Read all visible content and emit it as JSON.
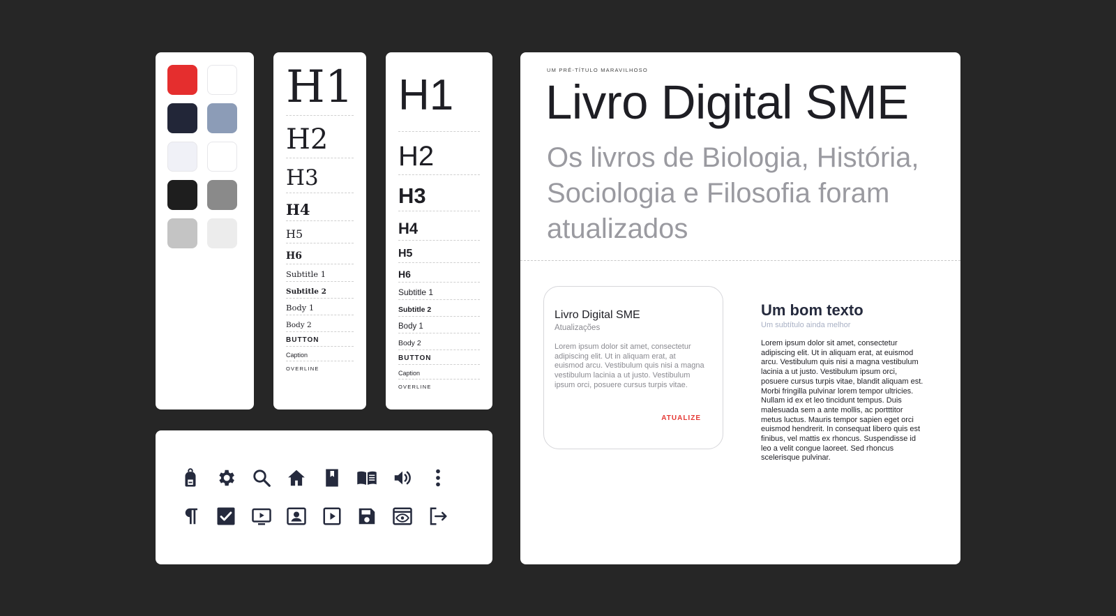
{
  "palette": {
    "swatches": [
      {
        "color": "#e52e2e",
        "name": "red"
      },
      {
        "color": "#ffffff",
        "name": "white"
      },
      {
        "color": "#222638",
        "name": "navy"
      },
      {
        "color": "#8c9cb7",
        "name": "slate-blue"
      },
      {
        "color": "#f0f1f7",
        "name": "ice"
      },
      {
        "color": "#ffffff",
        "name": "white"
      },
      {
        "color": "#1e1e1e",
        "name": "black"
      },
      {
        "color": "#8a8a8a",
        "name": "gray"
      },
      {
        "color": "#c4c4c4",
        "name": "silver"
      },
      {
        "color": "#ececec",
        "name": "light-gray"
      }
    ]
  },
  "typography_serif": {
    "styles": [
      {
        "label": "H1"
      },
      {
        "label": "H2"
      },
      {
        "label": "H3"
      },
      {
        "label": "H4"
      },
      {
        "label": "H5"
      },
      {
        "label": "H6"
      },
      {
        "label": "Subtitle 1"
      },
      {
        "label": "Subtitle 2"
      },
      {
        "label": "Body 1"
      },
      {
        "label": "Body 2"
      },
      {
        "label": "BUTTON"
      },
      {
        "label": "Caption"
      },
      {
        "label": "OVERLINE"
      }
    ]
  },
  "typography_sans": {
    "styles": [
      {
        "label": "H1"
      },
      {
        "label": "H2"
      },
      {
        "label": "H3"
      },
      {
        "label": "H4"
      },
      {
        "label": "H5"
      },
      {
        "label": "H6"
      },
      {
        "label": "Subtitle 1"
      },
      {
        "label": "Subtitle 2"
      },
      {
        "label": "Body 1"
      },
      {
        "label": "Body 2"
      },
      {
        "label": "BUTTON"
      },
      {
        "label": "Caption"
      },
      {
        "label": "OVERLINE"
      }
    ]
  },
  "icons": [
    "backpack-icon",
    "gear-icon",
    "search-icon",
    "home-icon",
    "bookmark-book-icon",
    "open-book-icon",
    "volume-icon",
    "more-vertical-icon",
    "paragraph-icon",
    "checkbox-icon",
    "video-player-icon",
    "contact-card-icon",
    "play-icon",
    "save-icon",
    "preview-icon",
    "logout-icon"
  ],
  "showcase": {
    "pretitle": "UM PRÉ-TÍTULO MARAVILHOSO",
    "title": "Livro Digital SME",
    "subtitle": "Os livros de Biologia, História, Sociologia e Filosofia foram atualizados",
    "card": {
      "title": "Livro Digital SME",
      "subtitle": "Atualizações",
      "body": "Lorem ipsum dolor sit amet, consectetur adipiscing elit. Ut in aliquam erat, at euismod arcu. Vestibulum quis nisi a magna vestibulum lacinia a ut justo. Vestibulum ipsum orci, posuere cursus turpis vitae.",
      "action": "ATUALIZE"
    },
    "text_block": {
      "title": "Um bom texto",
      "subtitle": "Um subtítulo ainda melhor",
      "body": "Lorem ipsum dolor sit amet, consectetur adipiscing elit. Ut in aliquam erat, at euismod arcu. Vestibulum quis nisi a magna vestibulum lacinia a ut justo. Vestibulum ipsum orci, posuere cursus turpis vitae, blandit aliquam est. Morbi fringilla pulvinar lorem tempor ultricies. Nullam id ex et leo tincidunt tempus. Duis malesuada sem a ante mollis, ac portttitor metus luctus. Mauris tempor sapien eget orci euismod hendrerit. In consequat libero quis est finibus, vel mattis ex rhoncus. Suspendisse id leo a velit congue laoreet. Sed rhoncus scelerisque pulvinar."
    }
  }
}
